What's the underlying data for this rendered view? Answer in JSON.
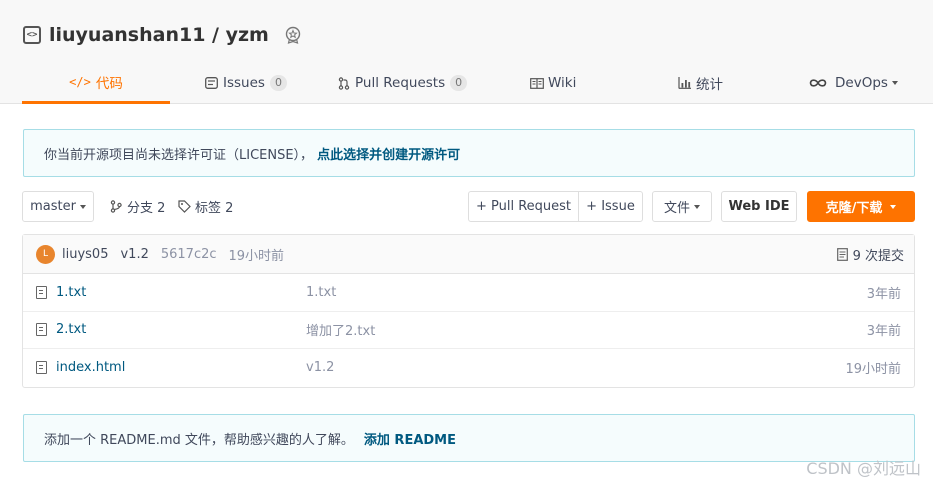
{
  "repo": {
    "owner": "liuyuanshan11",
    "separator": " / ",
    "name": "yzm"
  },
  "tabs": [
    {
      "label": "代码",
      "icon": "</>",
      "active": true
    },
    {
      "label": "Issues",
      "count": "0"
    },
    {
      "label": "Pull Requests",
      "count": "0"
    },
    {
      "label": "Wiki"
    },
    {
      "label": "统计"
    },
    {
      "label": "DevOps"
    }
  ],
  "license_notice": {
    "text": "你当前开源项目尚未选择许可证（LICENSE），",
    "link": "点此选择并创建开源许可"
  },
  "toolbar": {
    "branch": "master",
    "branches": "分支 2",
    "tags": "标签 2",
    "new_pr": "+ Pull Request",
    "new_issue": "+ Issue",
    "files": "文件",
    "web_ide": "Web IDE",
    "clone": "克隆/下载"
  },
  "last_commit": {
    "avatar_letter": "L",
    "author": "liuys05",
    "message": "v1.2",
    "sha": "5617c2c",
    "time": "19小时前",
    "commits": "9 次提交"
  },
  "files": [
    {
      "name": "1.txt",
      "message": "1.txt",
      "time": "3年前"
    },
    {
      "name": "2.txt",
      "message": "增加了2.txt",
      "time": "3年前"
    },
    {
      "name": "index.html",
      "message": "v1.2",
      "time": "19小时前"
    }
  ],
  "readme_notice": {
    "text": "添加一个 README.md 文件，帮助感兴趣的人了解。",
    "link": "添加 README"
  },
  "watermark": "CSDN @刘远山",
  "colors": {
    "accent": "#fe7300",
    "link": "#005980",
    "notice_border": "#a6dde6"
  }
}
